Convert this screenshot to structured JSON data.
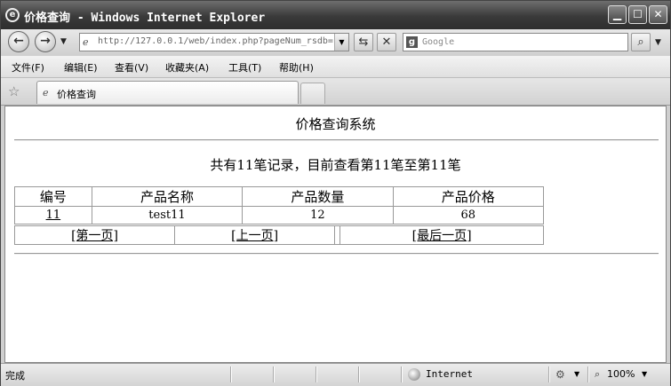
{
  "window": {
    "title": "价格查询 - Windows Internet Explorer",
    "minimize": "▁",
    "maximize": "☐",
    "close": "✕"
  },
  "nav": {
    "address": "http://127.0.0.1/web/index.php?pageNum_rsdb=",
    "search_placeholder": "Google"
  },
  "menu": {
    "items": [
      "文件(F)",
      "编辑(E)",
      "查看(V)",
      "收藏夹(A)",
      "工具(T)",
      "帮助(H)"
    ]
  },
  "tab": {
    "label": "价格查询"
  },
  "page": {
    "system_title": "价格查询系统",
    "summary": "共有11笔记录，目前查看第11笔至第11笔",
    "table": {
      "headers": [
        "编号",
        "产品名称",
        "产品数量",
        "产品价格"
      ],
      "rows": [
        [
          "11",
          "test11",
          "12",
          "68"
        ]
      ]
    },
    "pager": [
      "[第一页]",
      "[上一页]",
      "[最后一页]"
    ]
  },
  "status": {
    "text": "完成",
    "zone": "Internet",
    "zoom": "100%"
  }
}
